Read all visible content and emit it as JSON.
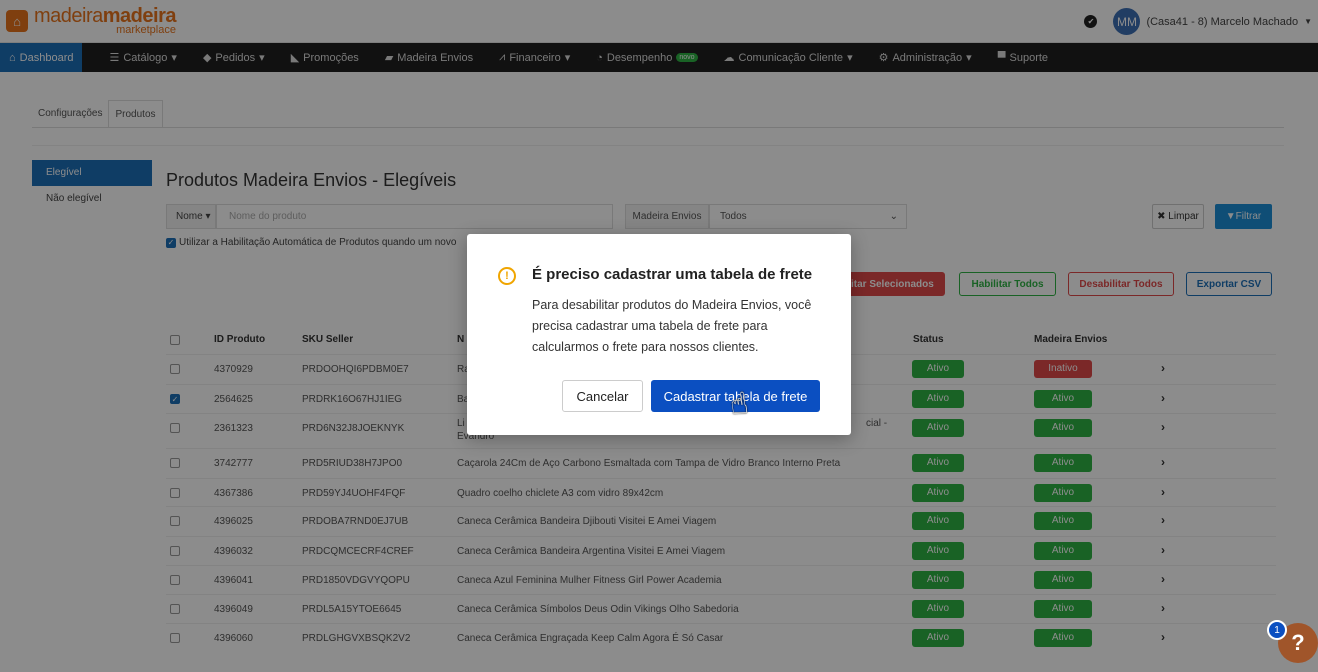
{
  "header": {
    "logo_main_a": "madeira",
    "logo_main_b": "madeira",
    "logo_sub": "marketplace",
    "avatar_initials": "MM",
    "user_name": "(Casa41 - 8) Marcelo Machado"
  },
  "nav": {
    "items": [
      {
        "label": "Dashboard",
        "icon": "home-icon"
      },
      {
        "label": "Catálogo",
        "icon": "list-icon"
      },
      {
        "label": "Pedidos",
        "icon": "box-icon"
      },
      {
        "label": "Promoções",
        "icon": "tag-icon"
      },
      {
        "label": "Madeira Envios",
        "icon": "truck-icon"
      },
      {
        "label": "Financeiro",
        "icon": "chart-icon"
      },
      {
        "label": "Desempenho",
        "icon": "gauge-icon",
        "badge": "novo"
      },
      {
        "label": "Comunicação Cliente",
        "icon": "chat-icon"
      },
      {
        "label": "Administração",
        "icon": "gear-icon"
      },
      {
        "label": "Suporte",
        "icon": "message-icon"
      }
    ]
  },
  "subtabs": [
    "Configurações",
    "Produtos"
  ],
  "sidebar": [
    "Elegível",
    "Não elegível"
  ],
  "page_title": "Produtos Madeira Envios - Elegíveis",
  "filters": {
    "name_dropdown": "Nome",
    "name_placeholder": "Nome do produto",
    "envios_label": "Madeira Envios",
    "envios_value": "Todos",
    "clear_label": "Limpar",
    "filter_label": "Filtrar"
  },
  "auto_habilitacao": "Utilizar a Habilitação Automática de Produtos quando um novo",
  "actions": {
    "disable_selected": "litar Selecionados",
    "enable_all": "Habilitar Todos",
    "disable_all": "Desabilitar Todos",
    "export_csv": "Exportar CSV"
  },
  "table": {
    "headers": {
      "id": "ID Produto",
      "sku": "SKU Seller",
      "name": "N",
      "status": "Status",
      "envios": "Madeira Envios"
    },
    "rows": [
      {
        "checked": false,
        "id": "4370929",
        "sku": "PRDOOHQI6PDBM0E7",
        "name": "Ra",
        "status": "Ativo",
        "envios": "Inativo"
      },
      {
        "checked": true,
        "id": "2564625",
        "sku": "PRDRK16O67HJ1IEG",
        "name": "Ba",
        "status": "Ativo",
        "envios": "Ativo"
      },
      {
        "checked": false,
        "id": "2361323",
        "sku": "PRD6N32J8JOEKNYK",
        "name": "Li",
        "name_tail": "cial -",
        "name_line2": "Evandro",
        "status": "Ativo",
        "envios": "Ativo"
      },
      {
        "checked": false,
        "id": "3742777",
        "sku": "PRD5RIUD38H7JPO0",
        "name": "Caçarola 24Cm de Aço Carbono Esmaltada com Tampa de Vidro Branco Interno Preta",
        "status": "Ativo",
        "envios": "Ativo"
      },
      {
        "checked": false,
        "id": "4367386",
        "sku": "PRD59YJ4UOHF4FQF",
        "name": "Quadro coelho chiclete A3 com vidro 89x42cm",
        "status": "Ativo",
        "envios": "Ativo"
      },
      {
        "checked": false,
        "id": "4396025",
        "sku": "PRDOBA7RND0EJ7UB",
        "name": "Caneca Cerâmica Bandeira Djibouti Visitei E Amei Viagem",
        "status": "Ativo",
        "envios": "Ativo"
      },
      {
        "checked": false,
        "id": "4396032",
        "sku": "PRDCQMCECRF4CREF",
        "name": "Caneca Cerâmica Bandeira Argentina Visitei E Amei Viagem",
        "status": "Ativo",
        "envios": "Ativo"
      },
      {
        "checked": false,
        "id": "4396041",
        "sku": "PRD1850VDGVYQOPU",
        "name": "Caneca Azul Feminina Mulher Fitness Girl Power Academia",
        "status": "Ativo",
        "envios": "Ativo"
      },
      {
        "checked": false,
        "id": "4396049",
        "sku": "PRDL5A15YTOE6645",
        "name": "Caneca Cerâmica Símbolos Deus Odin Vikings Olho Sabedoria",
        "status": "Ativo",
        "envios": "Ativo"
      },
      {
        "checked": false,
        "id": "4396060",
        "sku": "PRDLGHGVXBSQK2V2",
        "name": "Caneca Cerâmica Engraçada Keep Calm Agora É Só Casar",
        "status": "Ativo",
        "envios": "Ativo"
      }
    ]
  },
  "modal": {
    "title": "É preciso cadastrar uma tabela de frete",
    "body": "Para desabilitar produtos do Madeira Envios, você precisa cadastrar uma tabela de frete para calcularmos o frete para nossos clientes.",
    "cancel_label": "Cancelar",
    "confirm_label": "Cadastrar tabela de frete"
  },
  "help": {
    "count": "1",
    "symbol": "?"
  },
  "colors": {
    "brand_orange": "#e8741c",
    "primary_blue": "#0b4fc1",
    "nav_dark": "#1f1f1f",
    "active_green": "#2fb344",
    "inactive_red": "#e04a4a",
    "warning": "#f0a500"
  }
}
